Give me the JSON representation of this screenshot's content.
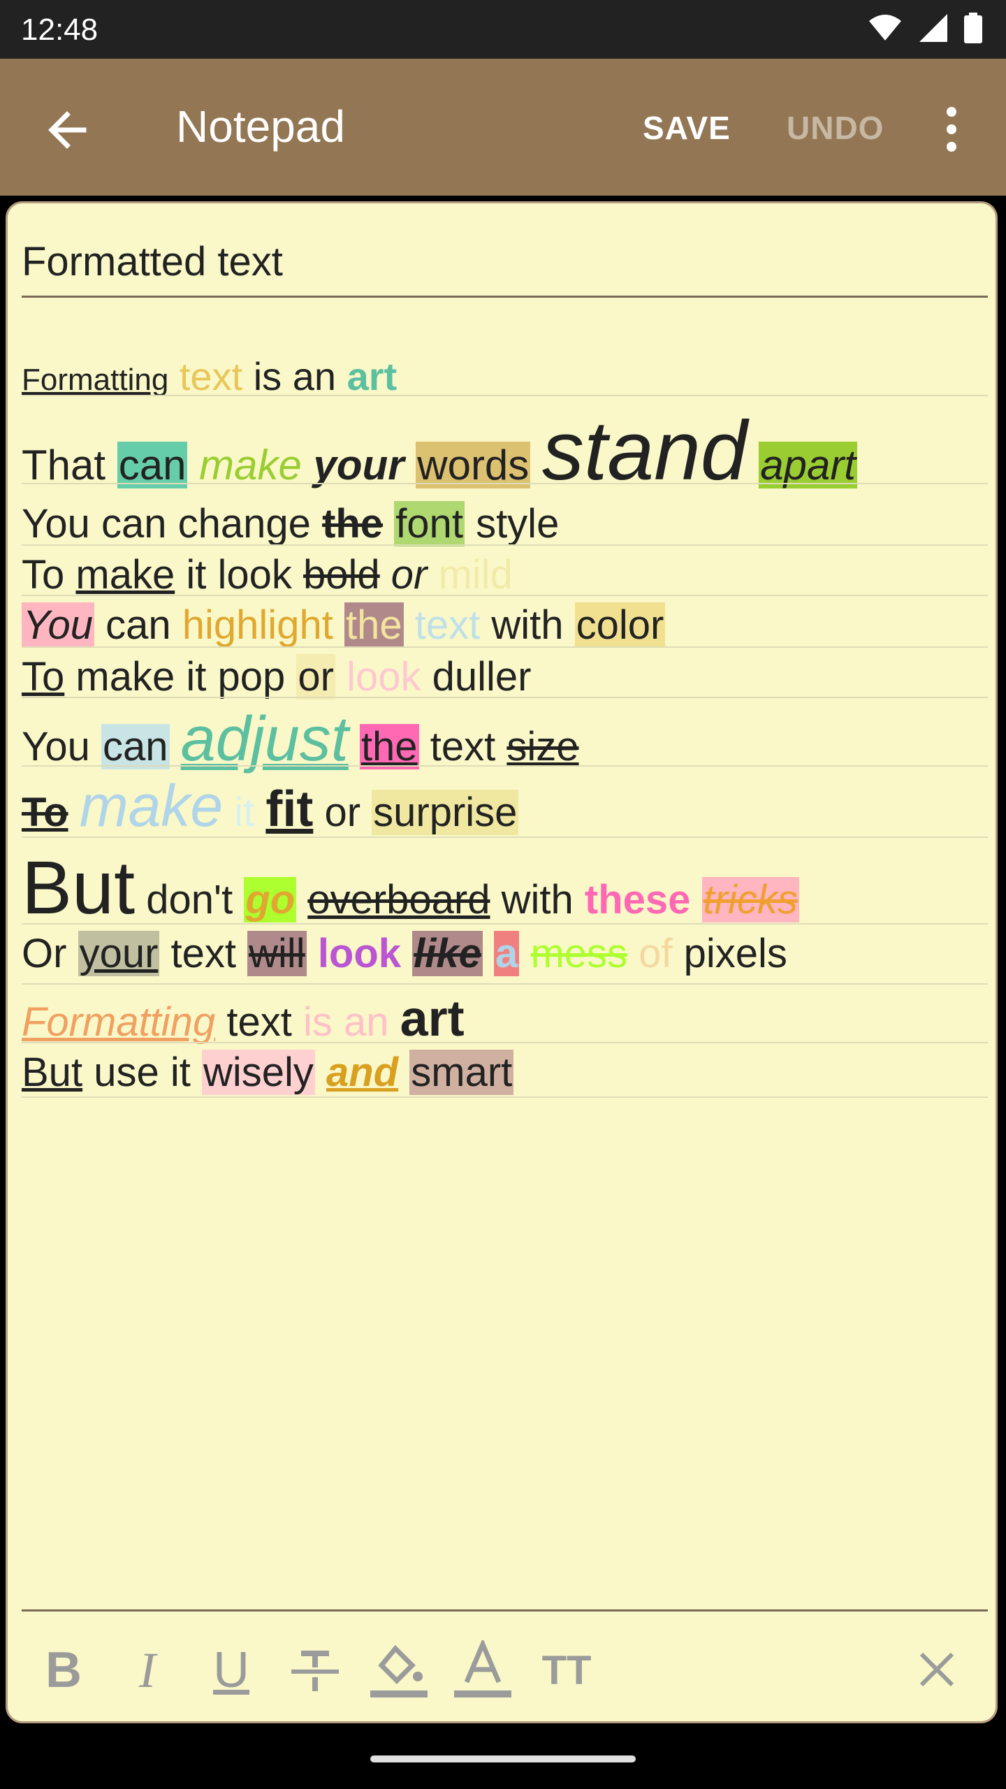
{
  "status_bar": {
    "time": "12:48"
  },
  "app_bar": {
    "title": "Notepad",
    "save_label": "SAVE",
    "undo_label": "UNDO"
  },
  "note": {
    "title": "Formatted text",
    "body": [
      "Formatting text is an art",
      "That can make your words stand apart",
      "You can change the font style",
      "To make it look bold or mild",
      "You can highlight the text with color",
      "To make it pop or look duller",
      "You can adjust the text size",
      "To make it fit or surprise",
      "But don't go overboard with these tricks",
      "Or your text will look like a mess of pixels",
      "Formatting text is an art",
      "But use it wisely and smart"
    ]
  },
  "toolbar": {
    "bold": "B",
    "italic": "I",
    "underline": "U",
    "text_color": "A",
    "text_size": "TT"
  },
  "colors": {
    "status_bar": "#222222",
    "app_bar": "#937755",
    "paper": "#faf8c8",
    "border": "#b49c7e"
  }
}
